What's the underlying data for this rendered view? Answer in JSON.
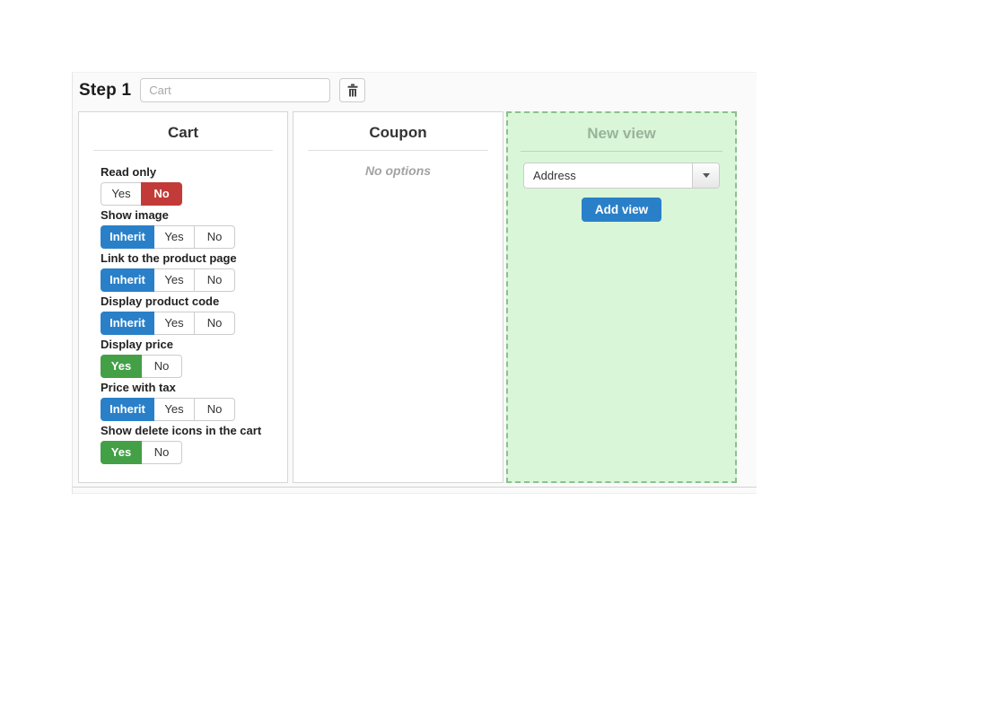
{
  "colors": {
    "blue": "#2a80c8",
    "green": "#43a047",
    "red": "#c23b38",
    "green_panel_bg": "#d9f6d9",
    "green_panel_border": "#8cc08c",
    "green_panel_title": "#9ab29a"
  },
  "icons": {
    "delete_step": "trash-icon",
    "view_select": "chevron-down-icon"
  },
  "header": {
    "title": "Step 1",
    "name_input": {
      "value": "",
      "placeholder": "Cart"
    }
  },
  "panels": {
    "cart": {
      "title": "Cart",
      "fields": [
        {
          "label": "Read only",
          "options": [
            "Yes",
            "No"
          ],
          "selected": "No",
          "selected_color": "red"
        },
        {
          "label": "Show image",
          "options": [
            "Inherit",
            "Yes",
            "No"
          ],
          "selected": "Inherit",
          "selected_color": "blue"
        },
        {
          "label": "Link to the product page",
          "options": [
            "Inherit",
            "Yes",
            "No"
          ],
          "selected": "Inherit",
          "selected_color": "blue"
        },
        {
          "label": "Display product code",
          "options": [
            "Inherit",
            "Yes",
            "No"
          ],
          "selected": "Inherit",
          "selected_color": "blue"
        },
        {
          "label": "Display price",
          "options": [
            "Yes",
            "No"
          ],
          "selected": "Yes",
          "selected_color": "green"
        },
        {
          "label": "Price with tax",
          "options": [
            "Inherit",
            "Yes",
            "No"
          ],
          "selected": "Inherit",
          "selected_color": "blue"
        },
        {
          "label": "Show delete icons in the cart",
          "options": [
            "Yes",
            "No"
          ],
          "selected": "Yes",
          "selected_color": "green"
        }
      ]
    },
    "coupon": {
      "title": "Coupon",
      "empty_text": "No options"
    },
    "new_view": {
      "title": "New view",
      "select_value": "Address",
      "add_button_label": "Add view"
    }
  }
}
